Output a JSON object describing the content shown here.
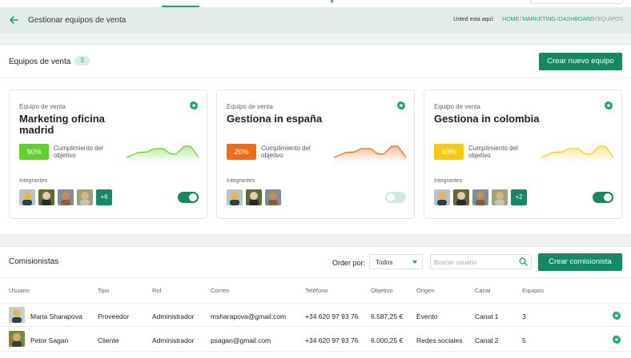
{
  "header": {
    "title": "Gestionar equipos de venta",
    "breadcrumb_label": "Usted esta aquí:",
    "breadcrumb": [
      "HOME",
      "MARKETING",
      "DASHBOARD"
    ],
    "breadcrumb_current": "EQUIPOS"
  },
  "teams": {
    "title": "Equipos de venta",
    "count": "3",
    "new_button": "Crear nuevo equipo",
    "cards": [
      {
        "subtitle": "Equipo de venta",
        "name": "Marketing oficina madrid",
        "percent": "90%",
        "progress": 0.9,
        "goal_label": "Cumplimiento del objetivo",
        "members_label": "Integrantes",
        "more": "+6",
        "active": true,
        "color": "#5fd12a",
        "icon": "gear-icon"
      },
      {
        "subtitle": "Equipo de venta",
        "name": "Gestiona in españa",
        "percent": "20%",
        "progress": 0.2,
        "goal_label": "Cumplimiento del objetivo",
        "members_label": "Integrantes",
        "more": "",
        "active": false,
        "color": "#f26a12",
        "icon": "gear-icon"
      },
      {
        "subtitle": "Equipo de venta",
        "name": "Gestiona in colombia",
        "percent": "60%",
        "progress": 0.6,
        "goal_label": "Cumplimiento del objetivo",
        "members_label": "Integrantes",
        "more": "+2",
        "active": true,
        "color": "#f7c910",
        "icon": "gear-icon"
      }
    ]
  },
  "commissions": {
    "title": "Comisionistas",
    "order_label": "Order por:",
    "order_value": "Todos",
    "search_placeholder": "Buscar usuario",
    "create_button": "Crear comisionista",
    "columns": [
      "Usuario",
      "Tipo",
      "Rol",
      "Correo",
      "Teléfono",
      "Objetivo",
      "Origen",
      "Canal",
      "Equipos"
    ],
    "rows": [
      {
        "user": "Maria Sharapova",
        "type": "Proveedor",
        "role": "Administrador",
        "email": "msharapova@gmail.com",
        "phone": "+34 620 97 93 76",
        "goal": "6.587,25 €",
        "origin": "Evento",
        "channel": "Canal 1",
        "teams": "3"
      },
      {
        "user": "Petor Sagan",
        "type": "Cliente",
        "role": "Administrador",
        "email": "psagan@gmail.com",
        "phone": "+34 620 97 93 76",
        "goal": "6.000,25 €",
        "origin": "Redes sociales",
        "channel": "Canal 2",
        "teams": "5"
      }
    ]
  },
  "colors": {
    "accent": "#128a63",
    "accent_light": "#17a67a",
    "header_bg": "#e4ece9"
  }
}
